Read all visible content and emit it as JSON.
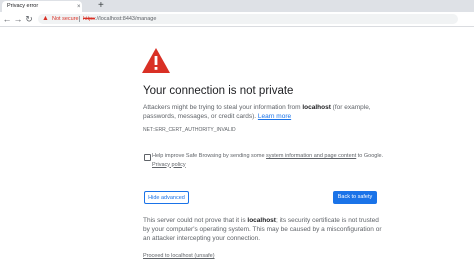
{
  "browser": {
    "tab_title": "Privacy error",
    "tab_close_glyph": "×",
    "new_tab_glyph": "+",
    "back_glyph": "←",
    "forward_glyph": "→",
    "reload_glyph": "↻",
    "not_secure_label": "Not secure",
    "url_scheme": "https",
    "url_rest": "://localhost:8443/manage"
  },
  "page": {
    "heading": "Your connection is not private",
    "description_pre": "Attackers might be trying to steal your information from ",
    "description_host": "localhost",
    "description_post": " (for example, passwords, messages, or credit cards). ",
    "learn_more": "Learn more",
    "error_code": "NET::ERR_CERT_AUTHORITY_INVALID",
    "safe_browsing_pre": "Help improve Safe Browsing by sending some ",
    "safe_browsing_link": "system information and page content",
    "safe_browsing_post": " to Google. ",
    "privacy_policy": "Privacy policy",
    "hide_advanced": "Hide advanced",
    "back_to_safety": "Back to safety",
    "details_pre": "This server could not prove that it is ",
    "details_host": "localhost",
    "details_post": "; its security certificate is not trusted by your computer's operating system. This may be caused by a misconfiguration or an attacker intercepting your connection.",
    "proceed_link": "Proceed to localhost (unsafe)"
  },
  "colors": {
    "warning_red": "#d93025",
    "link_blue": "#1a73e8"
  }
}
